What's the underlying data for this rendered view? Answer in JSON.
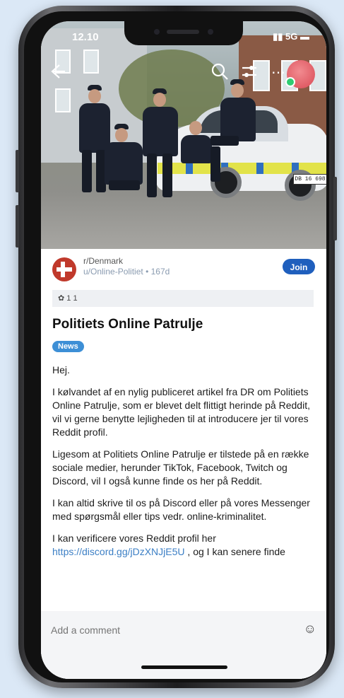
{
  "status": {
    "time": "12.10",
    "network": "5G"
  },
  "header_icons": {
    "back": "back-arrow-icon",
    "search": "search-icon",
    "sort": "sort-icon",
    "more": "more-icon"
  },
  "photo": {
    "plate_text": "DB 16 698"
  },
  "post": {
    "subreddit": "r/Denmark",
    "author": "u/Online-Politiet",
    "age": "167d",
    "join_label": "Join",
    "awards": "1   1",
    "title": "Politiets Online Patrulje",
    "flair": "News",
    "paragraphs": [
      "Hej.",
      "I kølvandet af en nylig publiceret artikel fra DR om Politiets Online Patrulje, som er blevet delt flittigt herinde på Reddit, vil vi gerne benytte lejligheden til at introducere jer til vores Reddit profil.",
      "Ligesom at Politiets Online Patrulje er tilstede på en række sociale medier, herunder TikTok, Facebook, Twitch og Discord, vil I også kunne finde os her på Reddit.",
      "I kan altid skrive til os på Discord eller på vores Messenger med spørgsmål eller tips vedr. online-kriminalitet."
    ],
    "last_paragraph_prefix": "I kan verificere vores Reddit profil her ",
    "last_paragraph_link": "https://discord.gg/jDzXNJjE5U",
    "last_paragraph_suffix": " , og I kan senere finde"
  },
  "comment": {
    "placeholder": "Add a comment"
  },
  "colors": {
    "join": "#1f5fbd",
    "flair": "#3d8fd6",
    "link": "#3c7fc5",
    "background": "#dbe8f6"
  }
}
